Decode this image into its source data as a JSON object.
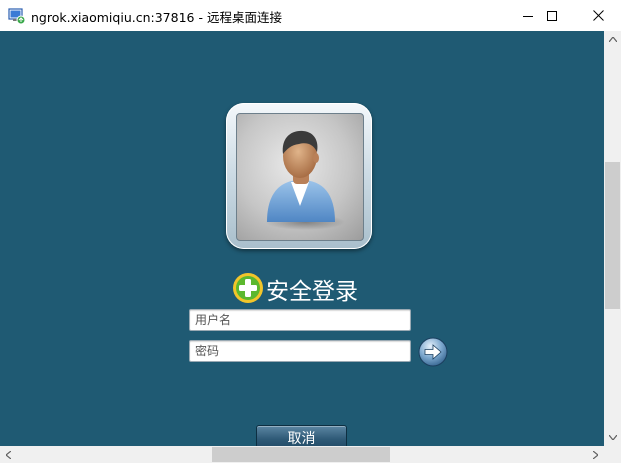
{
  "window": {
    "title": "ngrok.xiaomiqiu.cn:37816 - 远程桌面连接",
    "app_icon": "remote-desktop-icon",
    "controls": [
      "minimize-icon",
      "maximize-icon",
      "close-icon"
    ]
  },
  "login": {
    "avatar_icon": "user-avatar-icon",
    "badge_icon": "360-shield-plus-icon",
    "title": "安全登录",
    "username_placeholder": "用户名",
    "username_value": "",
    "password_placeholder": "密码",
    "password_value": "",
    "submit_icon": "arrow-right-icon",
    "cancel_label": "取消"
  },
  "colors": {
    "remote_background": "#1f5a73",
    "title_text": "#ffffff",
    "badge_green": "#5cb82e",
    "badge_yellow": "#f2c52a"
  }
}
